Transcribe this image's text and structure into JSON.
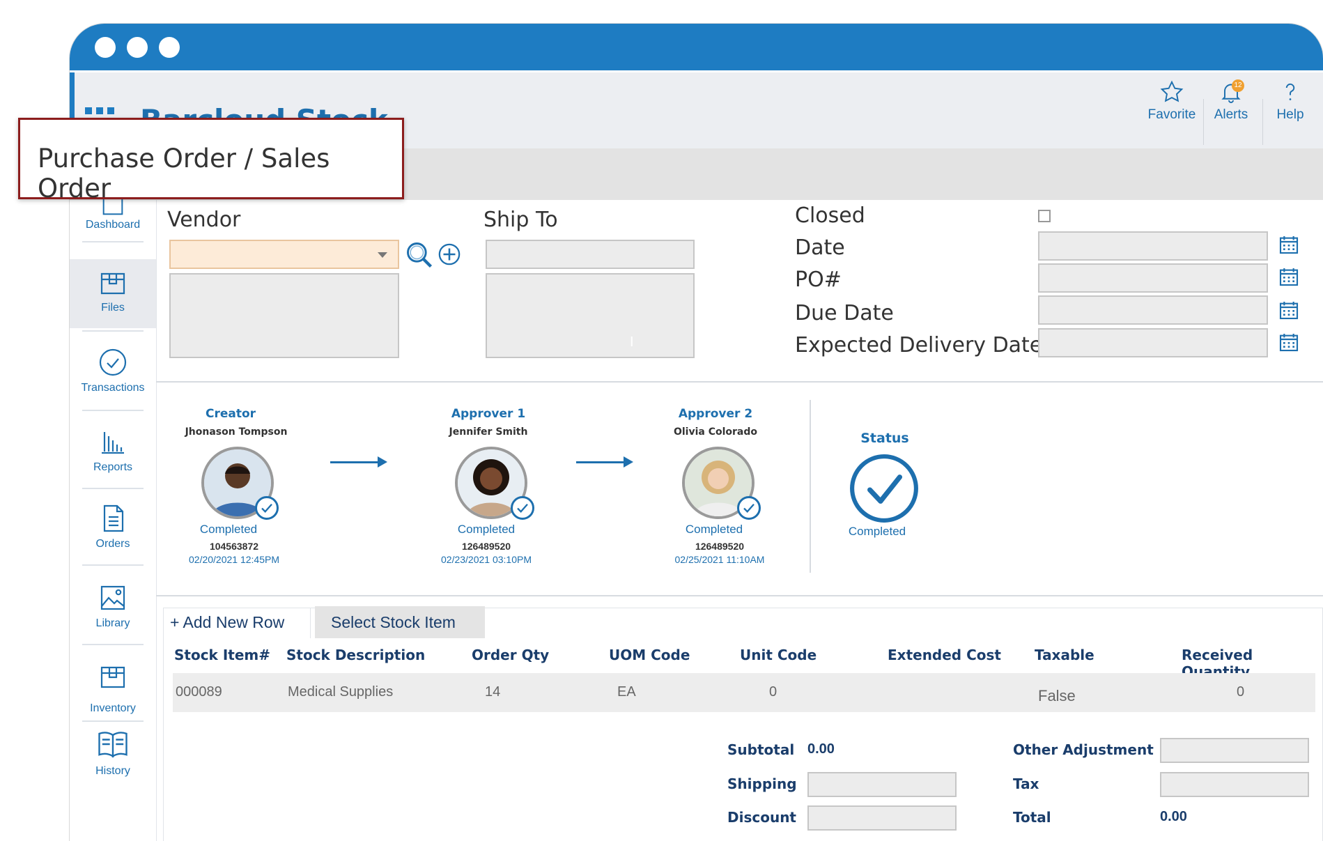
{
  "app": {
    "title": "Barcloud Stock"
  },
  "topbar": {
    "favorite": "Favorite",
    "alerts": "Alerts",
    "alerts_count": "12",
    "help": "Help"
  },
  "callout": {
    "text": "Purchase Order / Sales Order"
  },
  "sidebar": {
    "items": [
      {
        "label": "Dashboard"
      },
      {
        "label": "Files"
      },
      {
        "label": "Transactions"
      },
      {
        "label": "Reports"
      },
      {
        "label": "Orders"
      },
      {
        "label": "Library"
      },
      {
        "label": "Inventory"
      },
      {
        "label": "History"
      }
    ]
  },
  "form": {
    "vendor_label": "Vendor",
    "ship_to_label": "Ship To",
    "closed_label": "Closed",
    "date_label": "Date",
    "po_label": "PO#",
    "due_date_label": "Due Date",
    "expected_delivery_label": "Expected Delivery Date",
    "ship_to_cursor": "I"
  },
  "approvals": [
    {
      "role": "Creator",
      "name": "Jhonason Tompson",
      "state": "Completed",
      "id": "104563872",
      "time": "02/20/2021 12:45PM"
    },
    {
      "role": "Approver 1",
      "name": "Jennifer Smith",
      "state": "Completed",
      "id": "126489520",
      "time": "02/23/2021 03:10PM"
    },
    {
      "role": "Approver 2",
      "name": "Olivia Colorado",
      "state": "Completed",
      "id": "126489520",
      "time": "02/25/2021 11:10AM"
    }
  ],
  "status": {
    "label": "Status",
    "value": "Completed"
  },
  "table": {
    "add_row": "+ Add New Row",
    "select_item": "Select Stock Item",
    "headers": [
      "Stock Item#",
      "Stock Description",
      "Order Qty",
      "UOM Code",
      "Unit Code",
      "Extended Cost",
      "Taxable",
      "Received Quantity"
    ],
    "rows": [
      [
        "000089",
        "Medical Supplies",
        "14",
        "EA",
        "0",
        "",
        "False",
        "0"
      ]
    ]
  },
  "totals": {
    "subtotal_label": "Subtotal",
    "subtotal_value": "0.00",
    "shipping_label": "Shipping",
    "discount_label": "Discount",
    "other_adjustment_label": "Other Adjustment",
    "tax_label": "Tax",
    "total_label": "Total",
    "total_value": "0.00"
  },
  "colors": {
    "brand": "#1e7cc2",
    "text_dark": "#1a3d6b",
    "callout_border": "#8c1d1d"
  }
}
